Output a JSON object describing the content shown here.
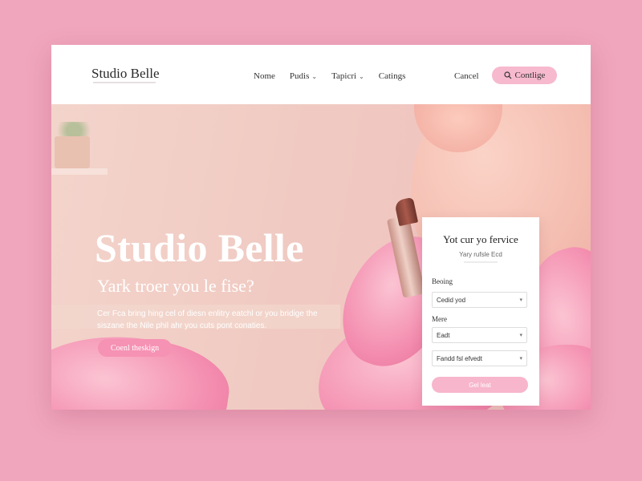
{
  "header": {
    "logo": "Studio Belle",
    "nav": [
      {
        "label": "Nome",
        "has_dropdown": false
      },
      {
        "label": "Pudis",
        "has_dropdown": true
      },
      {
        "label": "Tapicri",
        "has_dropdown": true
      },
      {
        "label": "Catings",
        "has_dropdown": false
      }
    ],
    "cancel_label": "Cancel",
    "cta_label": "Contlige",
    "cta_icon": "search-icon"
  },
  "hero": {
    "title": "Studio Belle",
    "subtitle": "Yark troer you le fise?",
    "description": "Cer Fca bring hing cel of diesn enlitry eatchl or you bridige the siszane the Nile phil ahr you cuts pont conaties.",
    "button_label": "Coenl theskign"
  },
  "booking_card": {
    "title": "Yot cur yo fervice",
    "subtitle": "Yary rufsle Ecd",
    "fields": [
      {
        "label": "Beoing",
        "value": "Cedid yod"
      },
      {
        "label": "Mere",
        "value": "Eadt"
      },
      {
        "label": "",
        "value": "Fandd fsl efvedt"
      }
    ],
    "submit_label": "Gel leat"
  },
  "colors": {
    "background": "#f0a6bd",
    "accent_pink": "#f7b9cd",
    "button_pink": "#f692b3"
  }
}
